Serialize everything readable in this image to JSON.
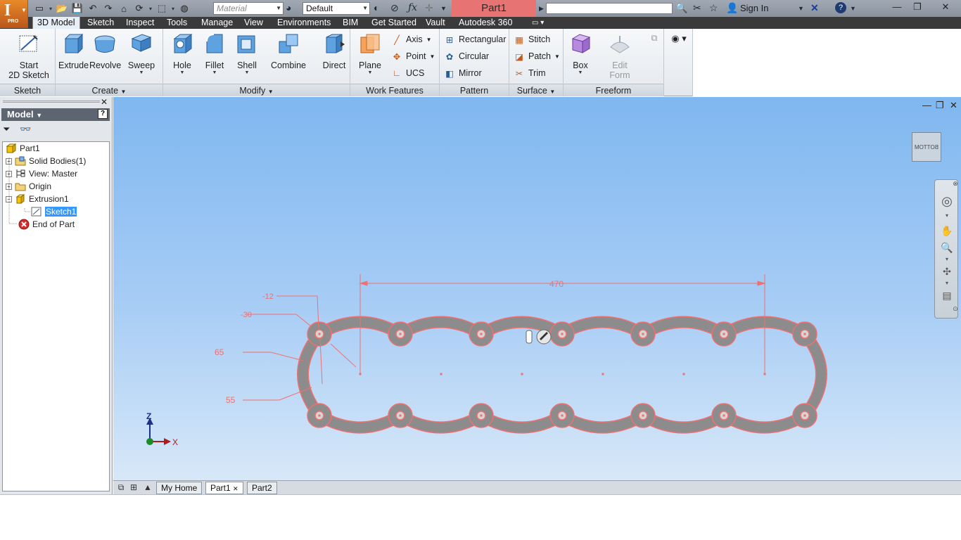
{
  "app": {
    "logo_letter": "I",
    "edition": "PRO",
    "document_title": "Part1"
  },
  "quick_access": {
    "material_placeholder": "Material",
    "appearance_value": "Default"
  },
  "header": {
    "sign_in": "Sign In"
  },
  "tabs": [
    "3D Model",
    "Sketch",
    "Inspect",
    "Tools",
    "Manage",
    "View",
    "Environments",
    "BIM",
    "Get Started",
    "Vault",
    "Autodesk 360"
  ],
  "ribbon": {
    "sketch": {
      "label": "Sketch",
      "start_line1": "Start",
      "start_line2": "2D Sketch"
    },
    "create": {
      "label": "Create",
      "extrude": "Extrude",
      "revolve": "Revolve",
      "sweep": "Sweep"
    },
    "modify": {
      "label": "Modify",
      "hole": "Hole",
      "fillet": "Fillet",
      "shell": "Shell",
      "combine": "Combine",
      "direct": "Direct"
    },
    "work_features": {
      "label": "Work Features",
      "plane": "Plane",
      "axis": "Axis",
      "point": "Point",
      "ucs": "UCS"
    },
    "pattern": {
      "label": "Pattern",
      "rectangular": "Rectangular",
      "circular": "Circular",
      "mirror": "Mirror"
    },
    "surface": {
      "label": "Surface",
      "stitch": "Stitch",
      "patch": "Patch",
      "trim": "Trim"
    },
    "freeform": {
      "label": "Freeform",
      "box": "Box",
      "edit_form_line1": "Edit",
      "edit_form_line2": "Form"
    }
  },
  "browser": {
    "title": "Model",
    "tree": [
      {
        "label": "Part1"
      },
      {
        "label": "Solid Bodies(1)"
      },
      {
        "label": "View: Master"
      },
      {
        "label": "Origin"
      },
      {
        "label": "Extrusion1"
      },
      {
        "label": "Sketch1"
      },
      {
        "label": "End of Part"
      }
    ]
  },
  "viewport": {
    "viewcube_face": "BOTTOM",
    "axis_z": "Z",
    "axis_x": "X",
    "dimensions": {
      "length": "470",
      "d12": "12",
      "d30": "30",
      "d65": "65",
      "d55": "55"
    }
  },
  "doc_tabs": [
    "My Home",
    "Part1",
    "Part2"
  ],
  "colors": {
    "sketch_line": "#f07070",
    "title_highlight": "#e77373",
    "selection": "#3399ff"
  }
}
